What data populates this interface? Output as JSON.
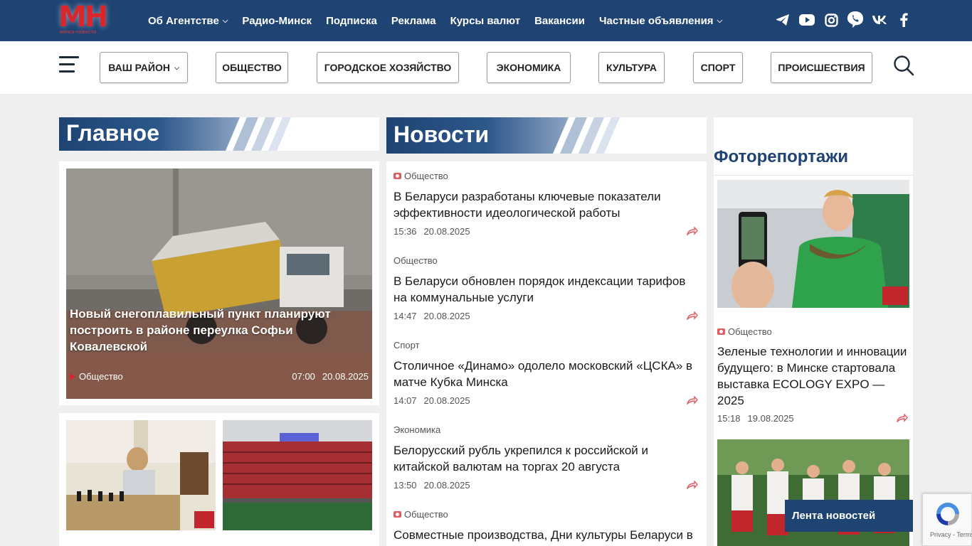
{
  "brand": {
    "logo_text": "МН",
    "logo_sub": "минск-новости"
  },
  "top_nav": [
    {
      "label": "Об Агентстве",
      "has_dropdown": true
    },
    {
      "label": "Радио-Минск",
      "has_dropdown": false
    },
    {
      "label": "Подписка",
      "has_dropdown": false
    },
    {
      "label": "Реклама",
      "has_dropdown": false
    },
    {
      "label": "Курсы валют",
      "has_dropdown": false
    },
    {
      "label": "Вакансии",
      "has_dropdown": false
    },
    {
      "label": "Частные объявления",
      "has_dropdown": true
    }
  ],
  "socials": [
    "telegram-icon",
    "youtube-icon",
    "instagram-icon",
    "viber-icon",
    "vk-icon",
    "facebook-icon"
  ],
  "categories": [
    {
      "label": "Ваш район",
      "has_dropdown": true
    },
    {
      "label": "Общество"
    },
    {
      "label": "Городское хозяйство"
    },
    {
      "label": "Экономика"
    },
    {
      "label": "Культура"
    },
    {
      "label": "Спорт"
    },
    {
      "label": "Происшествия"
    }
  ],
  "sections": {
    "main": "Главное",
    "news": "Новости",
    "photo": "Фоторепортажи"
  },
  "main_story": {
    "title": "Новый снегоплавильный пункт планируют построить в районе переулка Софьи Ковалевской",
    "rubric": "Общество",
    "time": "07:00",
    "date": "20.08.2025"
  },
  "news": [
    {
      "rubric": "Общество",
      "photo": true,
      "title": "В Беларуси разработаны ключевые показатели эффективности идеологической работы",
      "time": "15:36",
      "date": "20.08.2025"
    },
    {
      "rubric": "Общество",
      "photo": false,
      "title": "В Беларуси обновлен порядок индексации тарифов на коммунальные услуги",
      "time": "14:47",
      "date": "20.08.2025"
    },
    {
      "rubric": "Спорт",
      "photo": false,
      "title": "Столичное «Динамо» одолело московский «ЦСКА» в матче Кубка Минска",
      "time": "14:07",
      "date": "20.08.2025"
    },
    {
      "rubric": "Экономика",
      "photo": false,
      "title": "Белорусский рубль укрепился к российской и китайской валютам на торгах 20 августа",
      "time": "13:50",
      "date": "20.08.2025"
    },
    {
      "rubric": "Общество",
      "photo": true,
      "title": "Совместные производства, Дни культуры Беларуси в",
      "time": "",
      "date": ""
    }
  ],
  "photo_report": {
    "rubric": "Общество",
    "title": "Зеленые технологии и инновации будущего: в Минске стартовала выставка ECOLOGY EXPO — 2025",
    "time": "15:18",
    "date": "19.08.2025"
  },
  "feed_button": "Лента новостей",
  "recaptcha": {
    "links": "Privacy - Terms"
  },
  "colors": {
    "brand_blue": "#1f4473",
    "accent_red": "#d8262c"
  }
}
